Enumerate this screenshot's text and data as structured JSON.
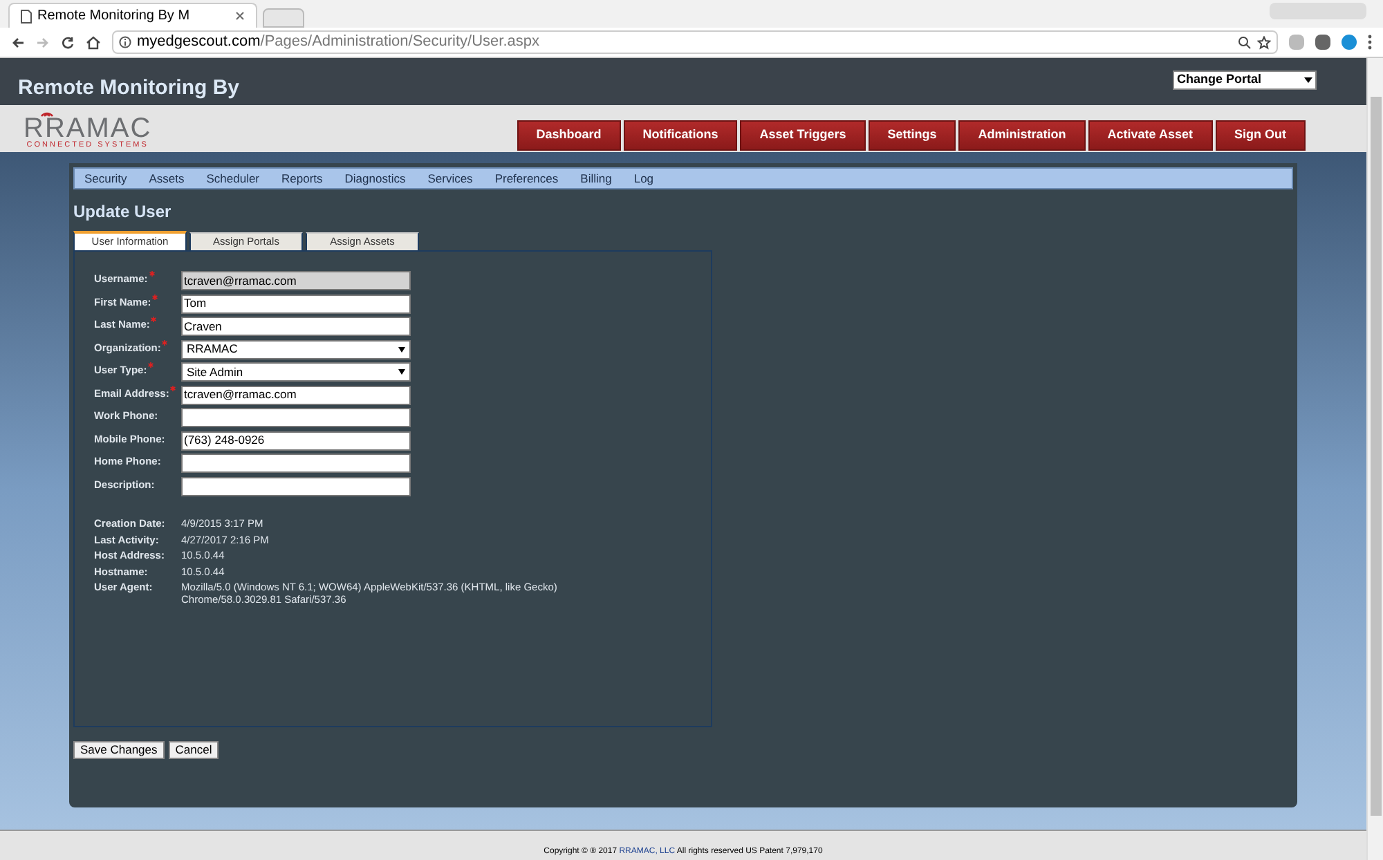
{
  "browser": {
    "tab_title": "Remote Monitoring By M",
    "url_host": "myedgescout.com",
    "url_path": "/Pages/Administration/Security/User.aspx"
  },
  "header": {
    "title": "Remote Monitoring By",
    "portal_select": "Change Portal"
  },
  "logo": {
    "name": "RRAMAC",
    "tagline": "CONNECTED SYSTEMS"
  },
  "nav_buttons": [
    "Dashboard",
    "Notifications",
    "Asset Triggers",
    "Settings",
    "Administration",
    "Activate Asset",
    "Sign Out"
  ],
  "submenu": [
    "Security",
    "Assets",
    "Scheduler",
    "Reports",
    "Diagnostics",
    "Services",
    "Preferences",
    "Billing",
    "Log"
  ],
  "page_title": "Update User",
  "tabs": [
    {
      "label": "User Information",
      "selected": true
    },
    {
      "label": "Assign Portals",
      "selected": false
    },
    {
      "label": "Assign Assets",
      "selected": false
    }
  ],
  "fields": [
    {
      "label": "Username:",
      "required": true,
      "kind": "text",
      "value": "tcraven@rramac.com",
      "disabled": true
    },
    {
      "label": "First Name:",
      "required": true,
      "kind": "text",
      "value": "Tom",
      "disabled": false
    },
    {
      "label": "Last Name:",
      "required": true,
      "kind": "text",
      "value": "Craven",
      "disabled": false
    },
    {
      "label": "Organization:",
      "required": true,
      "kind": "select",
      "value": "RRAMAC",
      "disabled": false
    },
    {
      "label": "User Type:",
      "required": true,
      "kind": "select",
      "value": "Site Admin",
      "disabled": false
    },
    {
      "label": "Email Address:",
      "required": true,
      "kind": "text",
      "value": "tcraven@rramac.com",
      "disabled": false
    },
    {
      "label": "Work Phone:",
      "required": false,
      "kind": "text",
      "disabled": false
    },
    {
      "label": "Mobile Phone:",
      "required": false,
      "kind": "text",
      "value": "(763) 248-0926",
      "disabled": false
    },
    {
      "label": "Home Phone:",
      "required": false,
      "kind": "text",
      "disabled": false
    },
    {
      "label": "Description:",
      "required": false,
      "kind": "text",
      "disabled": false
    }
  ],
  "info": [
    {
      "label": "Creation Date:",
      "value": "4/9/2015 3:17 PM"
    },
    {
      "label": "Last Activity:",
      "value": "4/27/2017 2:16 PM"
    },
    {
      "label": "Host Address:",
      "value": "10.5.0.44"
    },
    {
      "label": "Hostname:",
      "value": "10.5.0.44"
    },
    {
      "label": "User Agent:",
      "value": "Mozilla/5.0 (Windows NT 6.1; WOW64) AppleWebKit/537.36 (KHTML, like Gecko) Chrome/58.0.3029.81 Safari/537.36"
    }
  ],
  "actions": [
    "Save Changes",
    "Cancel"
  ],
  "footer": {
    "before": "Copyright © ® 2017",
    "link": "RRAMAC, LLC",
    "after": "All rights reserved US Patent 7,979,170"
  }
}
